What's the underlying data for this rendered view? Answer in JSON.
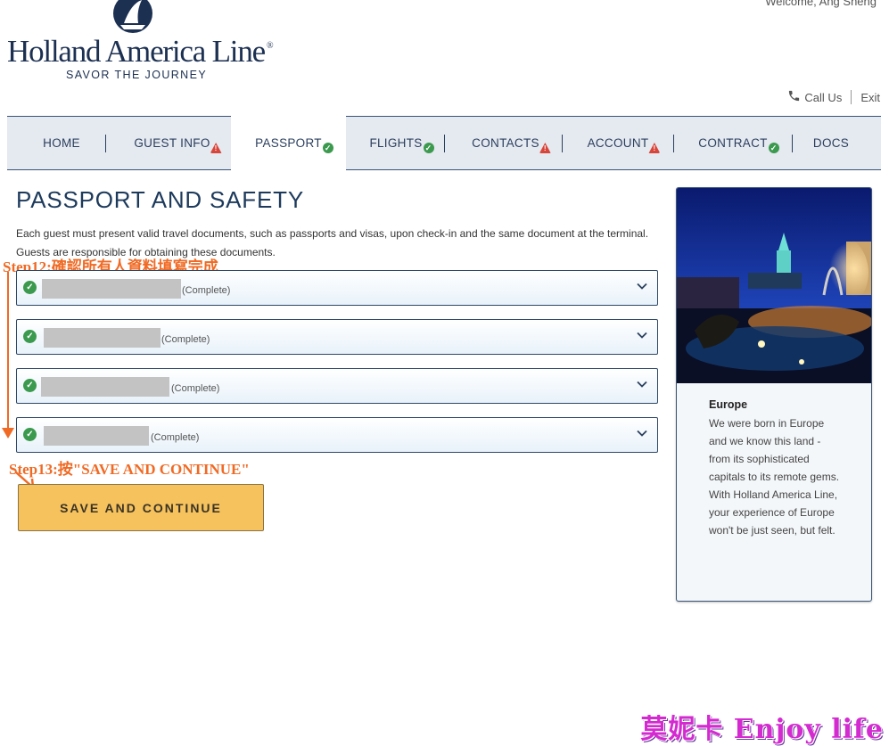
{
  "header": {
    "welcome_text": "Welcome, Ang Sheng",
    "brand_name": "Holland America Line",
    "brand_mark": "®",
    "tagline": "SAVOR THE JOURNEY",
    "call_label": "Call Us",
    "exit_label": "Exit"
  },
  "nav": {
    "tabs": [
      {
        "label": "HOME",
        "status": "none"
      },
      {
        "label": "GUEST INFO",
        "status": "warning"
      },
      {
        "label": "PASSPORT",
        "status": "complete",
        "active": true
      },
      {
        "label": "FLIGHTS",
        "status": "complete"
      },
      {
        "label": "CONTACTS",
        "status": "warning"
      },
      {
        "label": "ACCOUNT",
        "status": "warning"
      },
      {
        "label": "CONTRACT",
        "status": "complete"
      },
      {
        "label": "DOCS",
        "status": "none"
      }
    ]
  },
  "main": {
    "title": "PASSPORT AND SAFETY",
    "intro": "Each guest must present valid travel documents, such as passports and visas, upon check-in and the same document at the terminal. Guests are responsible for obtaining these documents.",
    "guests": [
      {
        "status_text": "(Complete)"
      },
      {
        "status_text": "(Complete)"
      },
      {
        "status_text": "(Complete)"
      },
      {
        "status_text": "(Complete)"
      }
    ],
    "save_label": "SAVE AND CONTINUE"
  },
  "annotations": {
    "step12": "Step12:確認所有人資料填寫完成",
    "step13": "Step13:按\"SAVE AND CONTINUE\""
  },
  "sidebar": {
    "card_title": "Europe",
    "card_text": "We were born in Europe and we know this land - from its sophisticated capitals to its remote gems. With Holland America Line, your experience of Europe won't be just seen, but felt."
  },
  "watermark": "莫妮卡 Enjoy life",
  "colors": {
    "navy": "#1c3052",
    "button": "#f5c25e",
    "complete": "#3b9a4e",
    "warning": "#d8453a",
    "annotation": "#f06a24"
  }
}
